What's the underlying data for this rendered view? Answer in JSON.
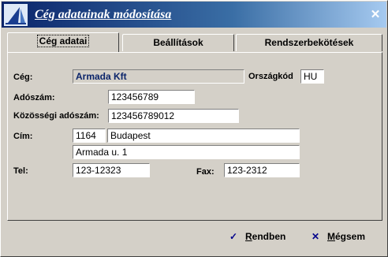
{
  "window": {
    "title": "Cég adatainak módosítása",
    "close_label": "✕"
  },
  "tabs": [
    {
      "label": "Cég adatai",
      "active": true
    },
    {
      "label": "Beállítások",
      "active": false
    },
    {
      "label": "Rendszerbekötések",
      "active": false
    }
  ],
  "form": {
    "company_label": "Cég:",
    "company_value": "Armada Kft",
    "country_label": "Országkód",
    "country_value": "HU",
    "tax_label": "Adószám:",
    "tax_value": "123456789",
    "eu_tax_label": "Közösségi adószám:",
    "eu_tax_value": "123456789012",
    "address_label": "Cím:",
    "zip_value": "1164",
    "city_value": "Budapest",
    "street_value": "Armada u. 1",
    "phone_label": "Tel:",
    "phone_value": "123-12323",
    "fax_label": "Fax:",
    "fax_value": "123-2312"
  },
  "buttons": {
    "ok_first": "R",
    "ok_rest": "endben",
    "cancel_first": "M",
    "cancel_rest": "égsem"
  }
}
